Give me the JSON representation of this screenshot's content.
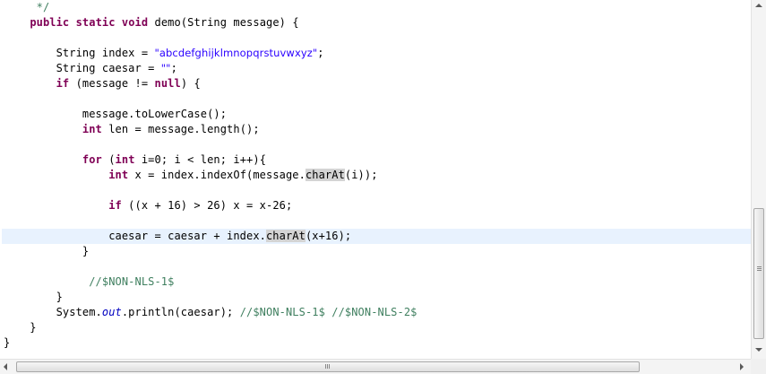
{
  "editor": {
    "language": "java",
    "current_line_index": 15,
    "colors": {
      "keyword": "#7f0055",
      "string": "#2a00ff",
      "comment": "#3f7f5f",
      "field": "#0000c0",
      "current_line": "#e8f2fe",
      "occurrence": "#d4d4d4"
    },
    "lines": [
      {
        "t": "     */",
        "c": "cmt"
      },
      {
        "tokens": [
          [
            "    ",
            ""
          ],
          [
            "public",
            "kw"
          ],
          [
            " ",
            ""
          ],
          [
            "static",
            "kw"
          ],
          [
            " ",
            ""
          ],
          [
            "void",
            "kw"
          ],
          [
            " demo(String message) {",
            ""
          ]
        ]
      },
      {
        "t": ""
      },
      {
        "tokens": [
          [
            "        String index = ",
            ""
          ],
          [
            "\"abcdefghijklmnopqrstuvwxyz\"",
            "str"
          ],
          [
            ";",
            ""
          ]
        ]
      },
      {
        "tokens": [
          [
            "        String caesar = ",
            ""
          ],
          [
            "\"\"",
            "str"
          ],
          [
            ";",
            ""
          ]
        ]
      },
      {
        "tokens": [
          [
            "        ",
            ""
          ],
          [
            "if",
            "kw"
          ],
          [
            " (message != ",
            ""
          ],
          [
            "null",
            "kw"
          ],
          [
            ") {",
            ""
          ]
        ]
      },
      {
        "t": ""
      },
      {
        "t": "            message.toLowerCase();"
      },
      {
        "tokens": [
          [
            "            ",
            ""
          ],
          [
            "int",
            "kw"
          ],
          [
            " len = message.length();",
            ""
          ]
        ]
      },
      {
        "t": ""
      },
      {
        "tokens": [
          [
            "            ",
            ""
          ],
          [
            "for",
            "kw"
          ],
          [
            " (",
            ""
          ],
          [
            "int",
            "kw"
          ],
          [
            " i=0; i < len; i++){",
            ""
          ]
        ]
      },
      {
        "tokens": [
          [
            "                ",
            ""
          ],
          [
            "int",
            "kw"
          ],
          [
            " x = index.indexOf(message.",
            ""
          ],
          [
            "charAt",
            "occ"
          ],
          [
            "(i));",
            ""
          ]
        ]
      },
      {
        "t": ""
      },
      {
        "tokens": [
          [
            "                ",
            ""
          ],
          [
            "if",
            "kw"
          ],
          [
            " ((x + 16) > 26) x = x-26;",
            ""
          ]
        ]
      },
      {
        "t": ""
      },
      {
        "tokens": [
          [
            "                caesar = caesar + index.",
            ""
          ],
          [
            "char",
            "occ"
          ],
          [
            "",
            "caret"
          ],
          [
            "At",
            "occ"
          ],
          [
            "(x+16);",
            ""
          ]
        ]
      },
      {
        "t": "            }"
      },
      {
        "t": ""
      },
      {
        "tokens": [
          [
            "             ",
            ""
          ],
          [
            "//$NON-NLS-1$",
            "cmt"
          ]
        ]
      },
      {
        "t": "        }"
      },
      {
        "tokens": [
          [
            "        System.",
            ""
          ],
          [
            "out",
            "fld"
          ],
          [
            ".println(caesar); ",
            ""
          ],
          [
            "//$NON-NLS-1$ //$NON-NLS-2$",
            "cmt"
          ]
        ]
      },
      {
        "t": "    }"
      },
      {
        "t": "}"
      }
    ]
  },
  "scrollbars": {
    "vertical": {
      "up": "scroll-up-arrow",
      "down": "scroll-down-arrow"
    },
    "horizontal": {
      "left": "scroll-left-arrow",
      "right": "scroll-right-arrow"
    }
  }
}
